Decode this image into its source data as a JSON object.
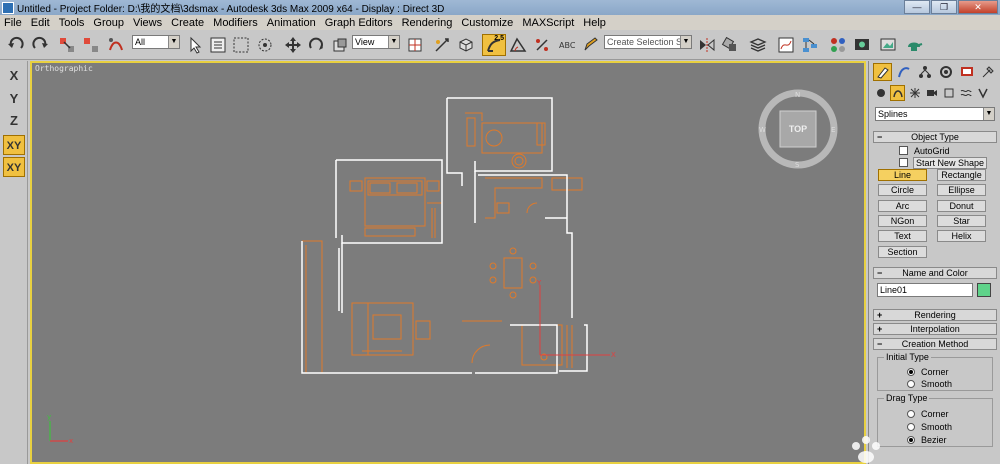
{
  "window": {
    "title": "Untitled    - Project Folder: D:\\我的文档\\3dsmax    - Autodesk 3ds Max  2009 x64    - Display : Direct 3D"
  },
  "menu": [
    "File",
    "Edit",
    "Tools",
    "Group",
    "Views",
    "Create",
    "Modifiers",
    "Animation",
    "Graph Editors",
    "Rendering",
    "Customize",
    "MAXScript",
    "Help"
  ],
  "toolbar": {
    "filter_select": "All",
    "refcoord_select": "View",
    "snap_label": "2.5",
    "selection_set_placeholder": "Create Selection Set"
  },
  "axis_constraints": [
    "X",
    "Y",
    "Z",
    "XY",
    "XY"
  ],
  "viewport": {
    "label": "Orthographic",
    "viewcube_label": "TOP"
  },
  "command_panel": {
    "category_select": "Splines",
    "object_type": {
      "title": "Object Type",
      "autogrid": "AutoGrid",
      "start_new_shape": "Start New Shape",
      "buttons": [
        "Line",
        "Rectangle",
        "Circle",
        "Ellipse",
        "Arc",
        "Donut",
        "NGon",
        "Star",
        "Text",
        "Helix",
        "Section"
      ]
    },
    "name_and_color": {
      "title": "Name and Color",
      "name": "Line01",
      "color": "#5fd38a"
    },
    "rendering_title": "Rendering",
    "interpolation_title": "Interpolation",
    "creation_method": {
      "title": "Creation Method",
      "initial_type": {
        "title": "Initial Type",
        "options": [
          "Corner",
          "Smooth"
        ],
        "selected": "Corner"
      },
      "drag_type": {
        "title": "Drag Type",
        "options": [
          "Corner",
          "Smooth",
          "Bezier"
        ],
        "selected": "Bezier"
      }
    }
  },
  "colors": {
    "viewport_bg": "#7c7c7c",
    "active_border": "#e8d040",
    "active_button": "#f0c040",
    "floorplan_walls": "#ffffff",
    "floorplan_furniture": "#e07a2a"
  }
}
